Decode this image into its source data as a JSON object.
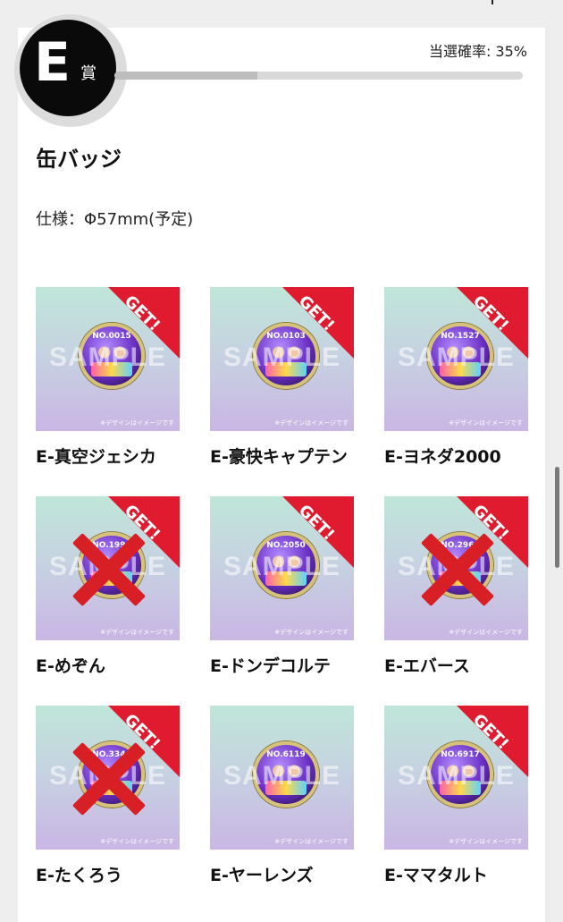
{
  "prize": {
    "letter": "E",
    "suffix": "賞",
    "odds_text": "当選確率: 35%",
    "odds_value": 0.35
  },
  "product": {
    "title": "缶バッジ",
    "spec": "仕様：Φ57mm(予定)"
  },
  "watermark": "SAMPLE",
  "image_note": "※デザインはイメージです",
  "get_label": "GET!",
  "items": [
    {
      "label": "E-真空ジェシカ",
      "number": "NO.0015",
      "got": true,
      "crossed": false
    },
    {
      "label": "E-豪快キャプテン",
      "number": "NO.0103",
      "got": true,
      "crossed": false
    },
    {
      "label": "E-ヨネダ2000",
      "number": "NO.1527",
      "got": true,
      "crossed": false
    },
    {
      "label": "E-めぞん",
      "number": "NO.1998",
      "got": true,
      "crossed": true
    },
    {
      "label": "E-ドンデコルテ",
      "number": "NO.2050",
      "got": true,
      "crossed": false
    },
    {
      "label": "E-エバース",
      "number": "NO.2963",
      "got": true,
      "crossed": true
    },
    {
      "label": "E-たくろう",
      "number": "NO.3344",
      "got": true,
      "crossed": true
    },
    {
      "label": "E-ヤーレンズ",
      "number": "NO.6119",
      "got": false,
      "crossed": false
    },
    {
      "label": "E-ママタルト",
      "number": "NO.6917",
      "got": true,
      "crossed": false
    }
  ]
}
